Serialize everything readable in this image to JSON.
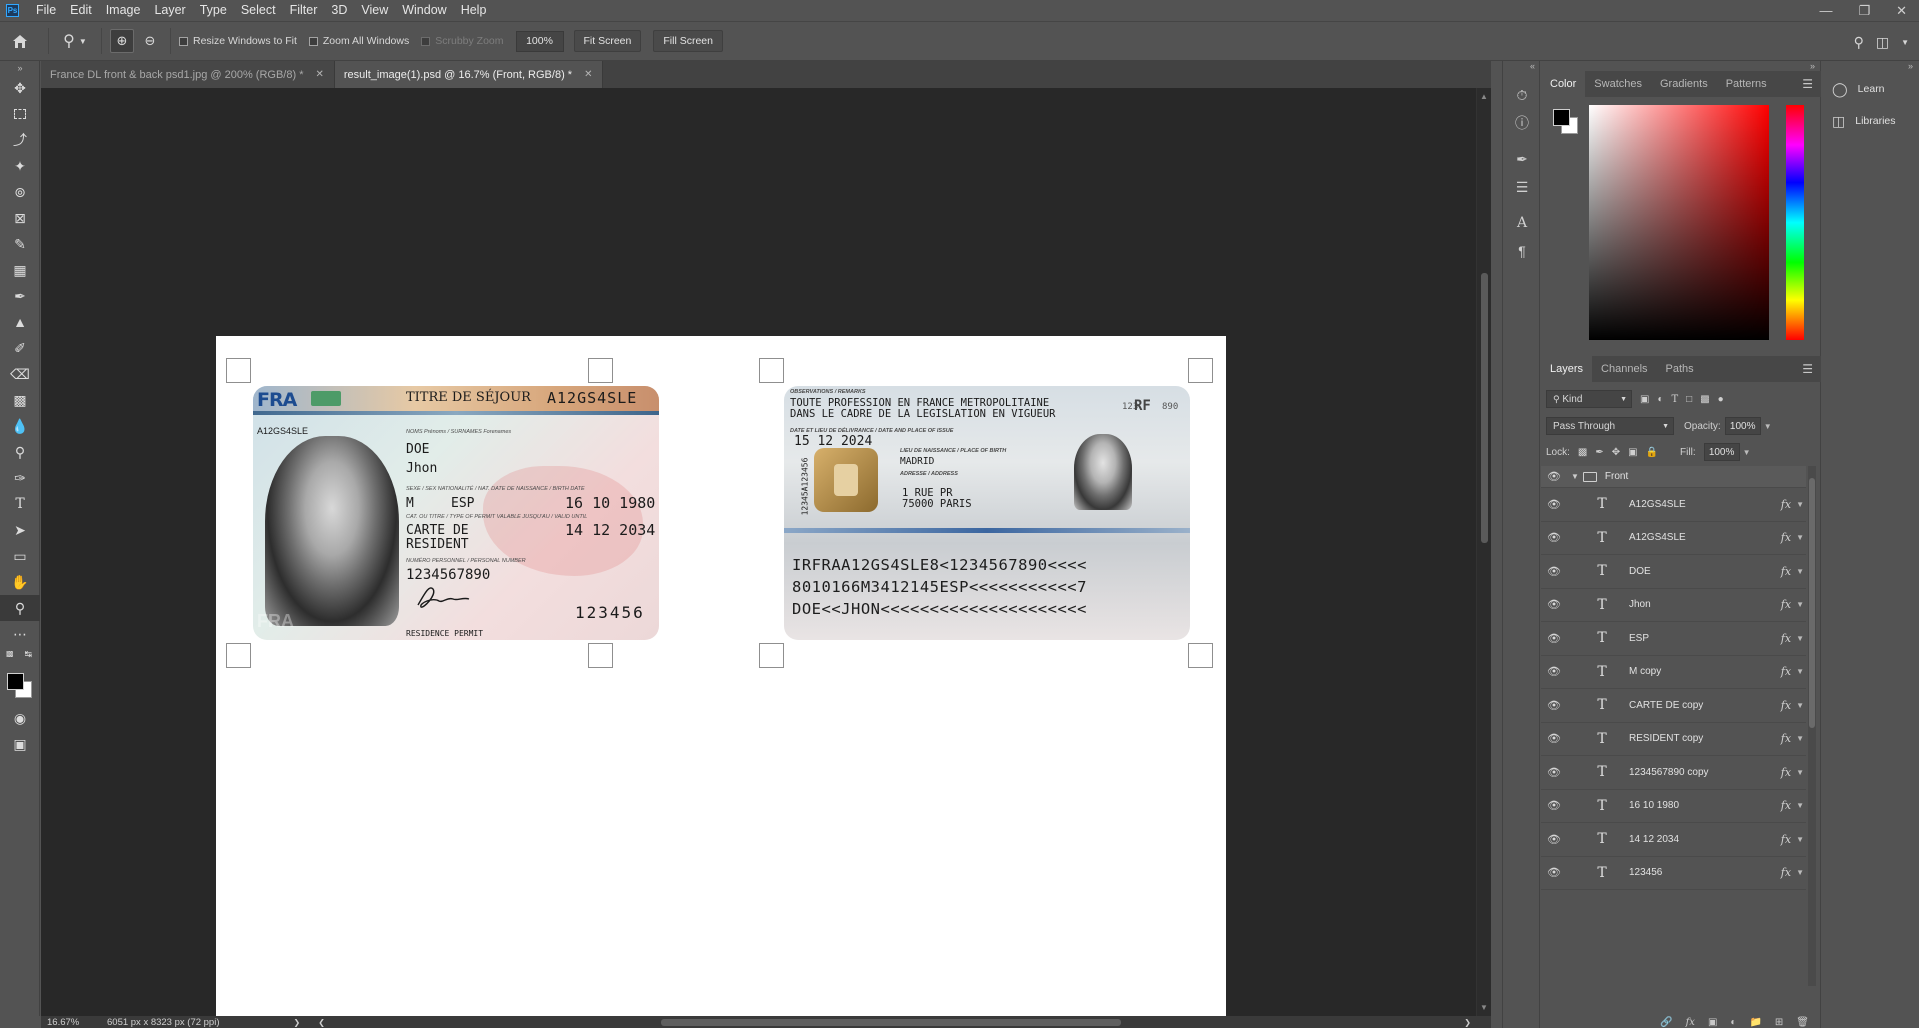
{
  "app": {
    "logo": "Ps"
  },
  "menu": [
    "File",
    "Edit",
    "Image",
    "Layer",
    "Type",
    "Select",
    "Filter",
    "3D",
    "View",
    "Window",
    "Help"
  ],
  "window_controls": [
    "minimize-icon",
    "restore-icon",
    "close-icon"
  ],
  "options_bar": {
    "resize_windows": "Resize Windows to Fit",
    "zoom_all": "Zoom All Windows",
    "scrubby_zoom": "Scrubby Zoom",
    "zoom_value": "100%",
    "fit_screen": "Fit Screen",
    "fill_screen": "Fill Screen"
  },
  "tabs": [
    {
      "label": "France DL front & back psd1.jpg @ 200% (RGB/8) *",
      "active": false
    },
    {
      "label": "result_image(1).psd @ 16.7% (Front, RGB/8) *",
      "active": true
    }
  ],
  "card_front": {
    "country": "FRA",
    "title": "TITRE DE SÉJOUR",
    "doc_number": "A12GS4SLE",
    "small_number": "A12GS4SLE",
    "label_names": "NOMS Prénoms / SURNAMES Forenames",
    "surname": "DOE",
    "given_name": "Jhon",
    "label_sex": "SEXE / SEX  NATIONALITÉ / NAT.   DATE DE NAISSANCE / BIRTH DATE",
    "sex": "M",
    "nationality": "ESP",
    "birth_date": "16 10 1980",
    "label_type": "CAT. OU TITRE / TYPE OF PERMIT   VALABLE JUSQU'AU / VALID UNTIL",
    "type_line1": "CARTE DE",
    "type_line2": "RESIDENT",
    "valid_until": "14 12 2034",
    "label_personal": "NUMÉRO PERSONNEL / PERSONAL NUMBER",
    "personal_number": "1234567890",
    "card_number": "123456",
    "footer": "RESIDENCE PERMIT",
    "bottom_ghost": "FRA"
  },
  "card_back": {
    "label_remarks": "OBSERVATIONS / REMARKS",
    "remarks_line1": "TOUTE PROFESSION EN FRANCE METROPOLITAINE",
    "remarks_line2": "DANS LE CADRE DE LA LEGISLATION EN VIGUEUR",
    "label_issue": "DATE ET LIEU DE DÉLIVRANCE / DATE AND PLACE OF ISSUE",
    "issue_date": "15 12 2024",
    "label_birthplace": "LIEU DE NAISSANCE / PLACE OF BIRTH",
    "birthplace": "MADRID",
    "label_address": "ADRESSE / ADDRESS",
    "address_line1": "1 RUE PR",
    "address_line2": "75000 PARIS",
    "side_number": "12345A123456",
    "top_right": "123",
    "top_right2": "890",
    "rf": "RF",
    "mrz": [
      "IRFRAA12GS4SLE8<1234567890<<<<",
      "8010166M3412145ESP<<<<<<<<<<<7",
      "DOE<<JHON<<<<<<<<<<<<<<<<<<<<<"
    ]
  },
  "status": {
    "zoom": "16.67%",
    "dimensions": "6051 px x 8323 px (72 ppi)"
  },
  "color_panel": {
    "tabs": [
      "Color",
      "Swatches",
      "Gradients",
      "Patterns"
    ]
  },
  "layers_panel": {
    "tabs": [
      "Layers",
      "Channels",
      "Paths"
    ],
    "kind": "Kind",
    "blend_mode": "Pass Through",
    "opacity_label": "Opacity:",
    "opacity": "100%",
    "lock_label": "Lock:",
    "fill_label": "Fill:",
    "fill": "100%",
    "group": "Front",
    "layers": [
      "A12GS4SLE",
      "A12GS4SLE",
      "DOE",
      "Jhon",
      "ESP",
      "M copy",
      "CARTE DE copy",
      "RESIDENT copy",
      "1234567890 copy",
      "16 10 1980",
      "14 12 2034",
      "123456"
    ],
    "fx_label": "fx"
  },
  "side_right": {
    "learn": "Learn",
    "libraries": "Libraries"
  }
}
